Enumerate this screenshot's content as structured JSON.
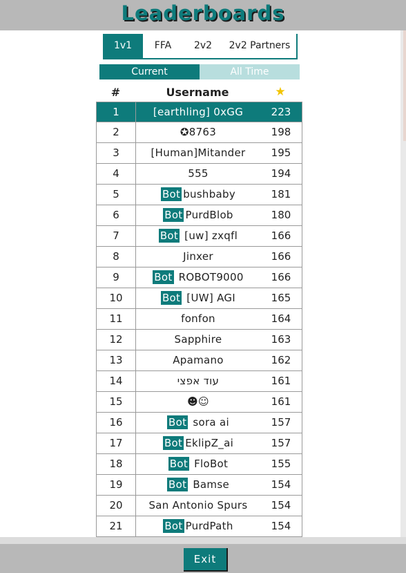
{
  "header": {
    "title": "Leaderboards"
  },
  "modes": [
    {
      "label": "1v1",
      "active": true
    },
    {
      "label": "FFA",
      "active": false
    },
    {
      "label": "2v2",
      "active": false
    },
    {
      "label": "2v2 Partners",
      "active": false
    }
  ],
  "periods": {
    "current": "Current",
    "all_time": "All Time"
  },
  "table": {
    "col_rank": "#",
    "col_username": "Username",
    "col_star": "★",
    "bot_label": "Bot",
    "rows": [
      {
        "rank": "1",
        "bot": false,
        "name": "[earthling] 0xGG",
        "stars": "223"
      },
      {
        "rank": "2",
        "bot": false,
        "name": "✪8763",
        "stars": "198"
      },
      {
        "rank": "3",
        "bot": false,
        "name": "[Human]Mitander",
        "stars": "195"
      },
      {
        "rank": "4",
        "bot": false,
        "name": "555",
        "stars": "194"
      },
      {
        "rank": "5",
        "bot": true,
        "name": "bushbaby",
        "stars": "181"
      },
      {
        "rank": "6",
        "bot": true,
        "name": "PurdBlob",
        "stars": "180"
      },
      {
        "rank": "7",
        "bot": true,
        "name": " [uw] zxqfl",
        "stars": "166"
      },
      {
        "rank": "8",
        "bot": false,
        "name": "Jinxer",
        "stars": "166"
      },
      {
        "rank": "9",
        "bot": true,
        "name": " ROBOT9000",
        "stars": "166"
      },
      {
        "rank": "10",
        "bot": true,
        "name": " [UW] AGI",
        "stars": "165"
      },
      {
        "rank": "11",
        "bot": false,
        "name": "fonfon",
        "stars": "164"
      },
      {
        "rank": "12",
        "bot": false,
        "name": "Sapphire",
        "stars": "163"
      },
      {
        "rank": "13",
        "bot": false,
        "name": "Apamano",
        "stars": "162"
      },
      {
        "rank": "14",
        "bot": false,
        "name": "עוד אפצי",
        "stars": "161"
      },
      {
        "rank": "15",
        "bot": false,
        "name": "☻☺",
        "stars": "161"
      },
      {
        "rank": "16",
        "bot": true,
        "name": " sora ai",
        "stars": "157"
      },
      {
        "rank": "17",
        "bot": true,
        "name": "EklipZ_ai",
        "stars": "157"
      },
      {
        "rank": "18",
        "bot": true,
        "name": " FloBot",
        "stars": "155"
      },
      {
        "rank": "19",
        "bot": true,
        "name": " Bamse",
        "stars": "154"
      },
      {
        "rank": "20",
        "bot": false,
        "name": "San Antonio Spurs",
        "stars": "154"
      },
      {
        "rank": "21",
        "bot": true,
        "name": "PurdPath",
        "stars": "154"
      }
    ]
  },
  "footer": {
    "exit_label": "Exit"
  },
  "colors": {
    "accent": "#0e7b7b",
    "bars": "#b8b8b8",
    "inactive_tab": "#b8dede",
    "star": "#f2c400"
  }
}
